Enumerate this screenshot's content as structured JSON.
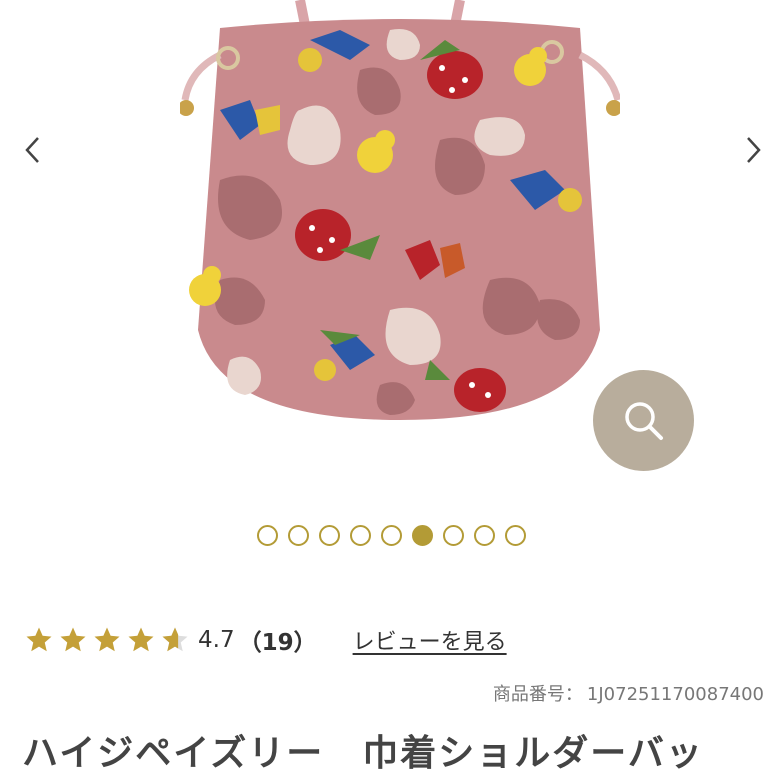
{
  "carousel": {
    "prev_icon": "chevron-left-icon",
    "next_icon": "chevron-right-icon",
    "zoom_icon": "search-icon",
    "image_alt": "pink paisley drawstring shoulder bag",
    "dot_count": 9,
    "active_dot_index": 5,
    "accent_color": "#b39b36",
    "zoom_bg_color": "#b8ad9c"
  },
  "rating": {
    "value": "4.7",
    "stars": 4.7,
    "count": "（19）",
    "review_link": "レビューを見る",
    "star_color": "#c4a038"
  },
  "product": {
    "item_number_label": "商品番号：",
    "item_number": "1J07251170087400",
    "title": "ハイジペイズリー　巾着ショルダーバッ"
  }
}
